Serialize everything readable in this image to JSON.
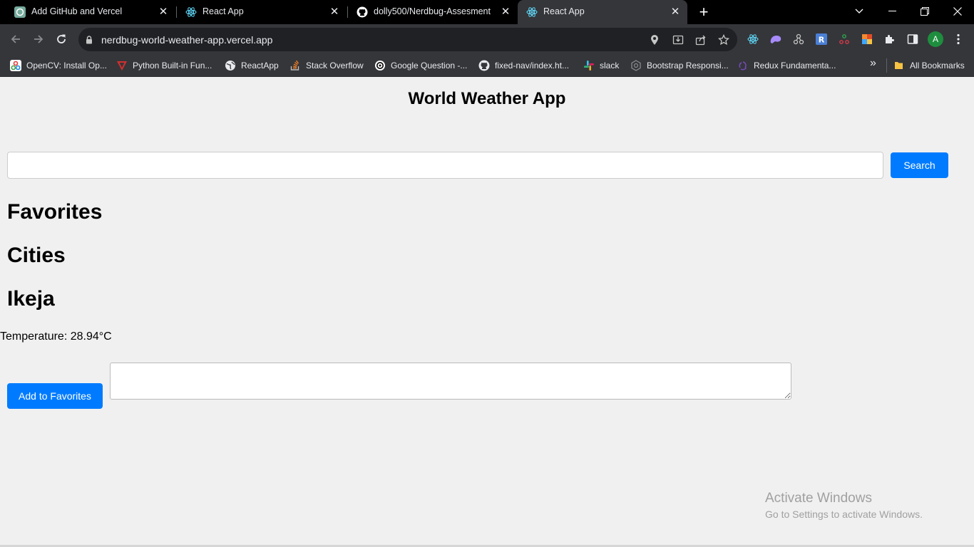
{
  "browser": {
    "tabs": [
      {
        "title": "Add GitHub and Vercel",
        "icon": "chatgpt-icon",
        "active": false
      },
      {
        "title": "React App",
        "icon": "react-icon",
        "active": false
      },
      {
        "title": "dolly500/Nerdbug-Assesment",
        "icon": "github-icon",
        "active": false
      },
      {
        "title": "React App",
        "icon": "react-icon",
        "active": true
      }
    ],
    "url": "nerdbug-world-weather-app.vercel.app",
    "profile_initial": "A",
    "bookmarks": [
      {
        "label": "OpenCV: Install Op...",
        "icon": "opencv-icon"
      },
      {
        "label": "Python Built-in Fun...",
        "icon": "python-icon"
      },
      {
        "label": "ReactApp",
        "icon": "globe-icon"
      },
      {
        "label": "Stack Overflow",
        "icon": "stackoverflow-icon"
      },
      {
        "label": "Google Question -...",
        "icon": "target-icon"
      },
      {
        "label": "fixed-nav/index.ht...",
        "icon": "github-icon"
      },
      {
        "label": "slack",
        "icon": "slack-icon"
      },
      {
        "label": "Bootstrap Responsi...",
        "icon": "bootstrap-icon"
      },
      {
        "label": "Redux Fundamenta...",
        "icon": "redux-icon"
      }
    ],
    "all_bookmarks_label": "All Bookmarks",
    "overflow_label": "»"
  },
  "app": {
    "title": "World Weather App",
    "search": {
      "value": "",
      "placeholder": "",
      "button_label": "Search"
    },
    "favorites_heading": "Favorites",
    "cities_heading": "Cities",
    "city_name": "Ikeja",
    "temperature_text": "Temperature: 28.94°C",
    "add_favorites_label": "Add to Favorites",
    "notes_value": ""
  },
  "watermark": {
    "line1": "Activate Windows",
    "line2": "Go to Settings to activate Windows."
  },
  "colors": {
    "accent": "#007bff",
    "page_bg": "#f0f0f0",
    "chrome_dark": "#35363a",
    "tabstrip": "#000000"
  }
}
